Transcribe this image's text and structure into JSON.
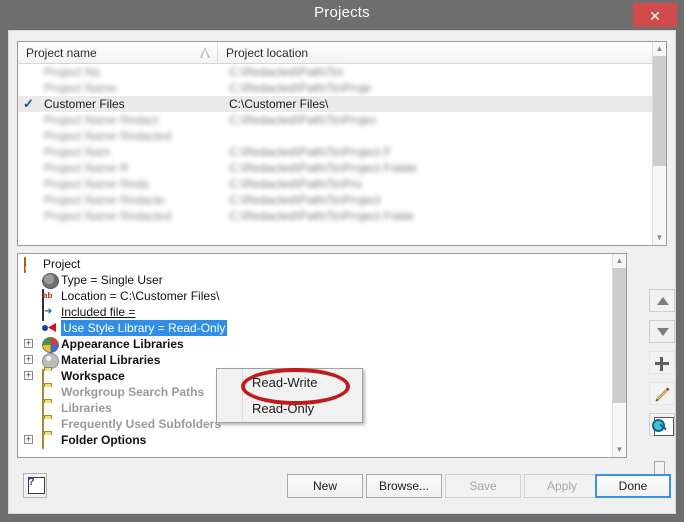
{
  "window": {
    "title": "Projects",
    "close_label": "✕",
    "close_icon": "close-icon",
    "frame_color": "#6e6e6e",
    "close_color": "#d14b4b",
    "client_color": "#f0f0f0"
  },
  "project_list": {
    "columns": [
      "Project name",
      "Project location"
    ],
    "sort_indicator": "ascending",
    "rows": [
      {
        "check": "",
        "name": "",
        "location": "",
        "redacted": true
      },
      {
        "check": "",
        "name": "",
        "location": "",
        "redacted": true
      },
      {
        "check": "✓",
        "name": "Customer Files",
        "location": "C:\\Customer Files\\",
        "redacted": false,
        "selected": true
      },
      {
        "check": "",
        "name": "",
        "location": "",
        "redacted": true
      },
      {
        "check": "",
        "name": "",
        "location": "",
        "redacted": true
      },
      {
        "check": "",
        "name": "",
        "location": "",
        "redacted": true
      },
      {
        "check": "",
        "name": "",
        "location": "",
        "redacted": true
      },
      {
        "check": "",
        "name": "",
        "location": "",
        "redacted": true
      },
      {
        "check": "",
        "name": "",
        "location": "",
        "redacted": true
      },
      {
        "check": "",
        "name": "",
        "location": "",
        "redacted": true
      }
    ],
    "redacted_name_placeholder": "Project Name Redacted",
    "redacted_loc_placeholder": "C:\\Redacted\\Path\\To\\Project Folder"
  },
  "project_tree": {
    "nodes": [
      {
        "label": "Project",
        "icon": "ipj-project-icon",
        "indent": 0,
        "expander": "",
        "style": "normal"
      },
      {
        "label": "Type = Single User",
        "icon": "user-type-icon",
        "indent": 1,
        "expander": "",
        "style": "normal"
      },
      {
        "label": "Location = C:\\Customer Files\\",
        "icon": "ab-text-icon",
        "indent": 1,
        "expander": "",
        "style": "normal"
      },
      {
        "label": "Included file = ",
        "icon": "included-file-icon",
        "indent": 1,
        "expander": "",
        "style": "underline"
      },
      {
        "label": "Use Style Library = Read-Only",
        "icon": "style-library-icon",
        "indent": 1,
        "expander": "",
        "style": "selected"
      },
      {
        "label": "Appearance Libraries",
        "icon": "appearance-library-icon",
        "indent": 1,
        "expander": "+",
        "style": "bold"
      },
      {
        "label": "Material Libraries",
        "icon": "material-library-icon",
        "indent": 1,
        "expander": "+",
        "style": "bold"
      },
      {
        "label": "Workspace",
        "icon": "folder-icon",
        "indent": 1,
        "expander": "+",
        "style": "bold"
      },
      {
        "label": "Workgroup Search Paths",
        "icon": "folder-icon",
        "indent": 1,
        "expander": "",
        "style": "bold-gray"
      },
      {
        "label": "Libraries",
        "icon": "folder-icon",
        "indent": 1,
        "expander": "",
        "style": "bold-gray"
      },
      {
        "label": "Frequently Used Subfolders",
        "icon": "folder-icon",
        "indent": 1,
        "expander": "",
        "style": "bold-gray"
      },
      {
        "label": "Folder Options",
        "icon": "folder-icon",
        "indent": 1,
        "expander": "+",
        "style": "bold"
      }
    ],
    "selected_highlight_color": "#2f8fe8"
  },
  "context_menu": {
    "items": [
      {
        "label": "Read-Write",
        "highlighted": true
      },
      {
        "label": "Read-Only",
        "highlighted": false
      }
    ],
    "annotation_color": "#c21a1a",
    "annotation_shape": "ellipse"
  },
  "side_toolbar": {
    "buttons": [
      {
        "icon": "move-up-icon",
        "enabled": true
      },
      {
        "icon": "move-down-icon",
        "enabled": true
      },
      {
        "icon": "add-plus-icon",
        "enabled": true
      },
      {
        "icon": "edit-pencil-icon",
        "enabled": true
      },
      {
        "icon": "find-document-icon",
        "enabled": true
      }
    ],
    "dropdown_icon": "chevron-down-icon"
  },
  "footer": {
    "help_icon": "help-question-icon",
    "buttons": [
      {
        "label": "New",
        "enabled": true,
        "default": false
      },
      {
        "label": "Browse...",
        "enabled": true,
        "default": false
      },
      {
        "label": "Save",
        "enabled": false,
        "default": false
      },
      {
        "label": "Apply",
        "enabled": false,
        "default": false
      },
      {
        "label": "Done",
        "enabled": true,
        "default": true
      }
    ]
  },
  "scrollbars": {
    "up_glyph": "▲",
    "down_glyph": "▼"
  }
}
